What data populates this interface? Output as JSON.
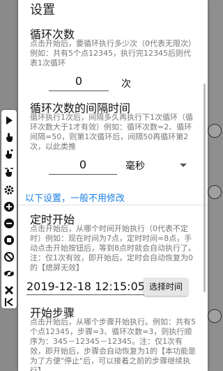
{
  "background_icons": [
    "search-icon",
    "settings-icon",
    "more-icon"
  ],
  "toolbar": {
    "items": [
      "play-icon",
      "touch-icon",
      "tap-icon",
      "swipe-icon",
      "settings-icon",
      "add-icon",
      "remove-icon",
      "stop-icon",
      "hide-icon",
      "eye-off-icon",
      "close-icon",
      "collapse-icon"
    ]
  },
  "dialog": {
    "title": "设置",
    "loop_count": {
      "title": "循环次数",
      "desc": "点击开始后，要循环执行多少次（0代表无限次）例如：共有5个点12345，执行完12345后则代表1次循环",
      "value": "0",
      "unit": "次"
    },
    "loop_interval": {
      "title": "循环次数的间隔时间",
      "desc": "循环执行1次后，间隔多久再执行下1次循环（循环次数大于1才有效）例如：循环次数=2、循环间隔=50，则第1次循环后，间隔50再循环第2次，以此类推",
      "value": "0",
      "unit_selected": "毫秒"
    },
    "link_text": "以下设置，一般不用修改",
    "timed_start": {
      "title": "定时开始",
      "desc": "点击开始后，从哪个时间开始执行（0代表不定时）例如：现在时间为7点，定时时间=8点，手动点击开始按钮后，等到8点时就会自动执行了。注：仅1次有效，即开始后，定时会自动恢复为0的【熄屏无效】",
      "datetime": "2019-12-18  12:15:05",
      "select_button": "选择时间"
    },
    "start_step": {
      "title": "开始步骤",
      "desc": "点击开始后，从哪个步骤开始执行。例如：共有5个点12345，步骤=3、循环次数=3，则执行顺序为：345－12345－12345。注：仅1次有效，即开始后，步骤会自动恢复为1的【本功能是为了方便\"停止\"后，可以接着之前的步骤继续执行】"
    }
  }
}
